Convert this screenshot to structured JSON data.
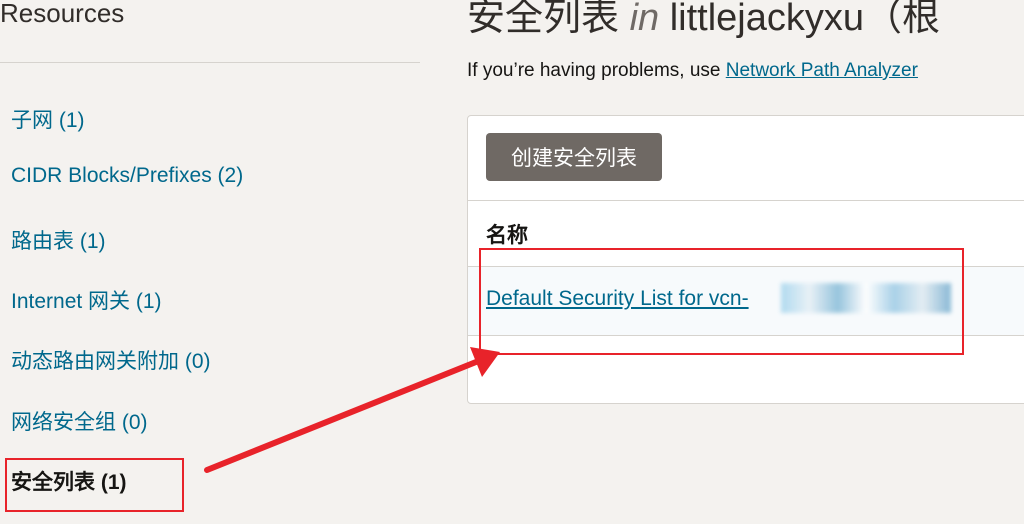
{
  "sidebar": {
    "title": "Resources",
    "items": [
      {
        "label": "子网 (1)"
      },
      {
        "label": "CIDR Blocks/Prefixes (2)"
      },
      {
        "label": "路由表 (1)"
      },
      {
        "label": "Internet 网关 (1)"
      },
      {
        "label": "动态路由网关附加 (0)"
      },
      {
        "label": "网络安全组 (0)"
      },
      {
        "label": "安全列表 (1)"
      }
    ]
  },
  "main": {
    "title_prefix": "安全列表",
    "title_in": "in",
    "title_compartment": "littlejackyxu（根",
    "subtitle_text": "If you’re having problems, use",
    "subtitle_link": "Network Path Analyzer",
    "create_button_label": "创建安全列表",
    "column_name": "名称",
    "rows": [
      {
        "name": "Default Security List for vcn-"
      }
    ]
  },
  "colors": {
    "link": "#00688c",
    "annotation": "#e8232a",
    "button": "#6f6964"
  }
}
